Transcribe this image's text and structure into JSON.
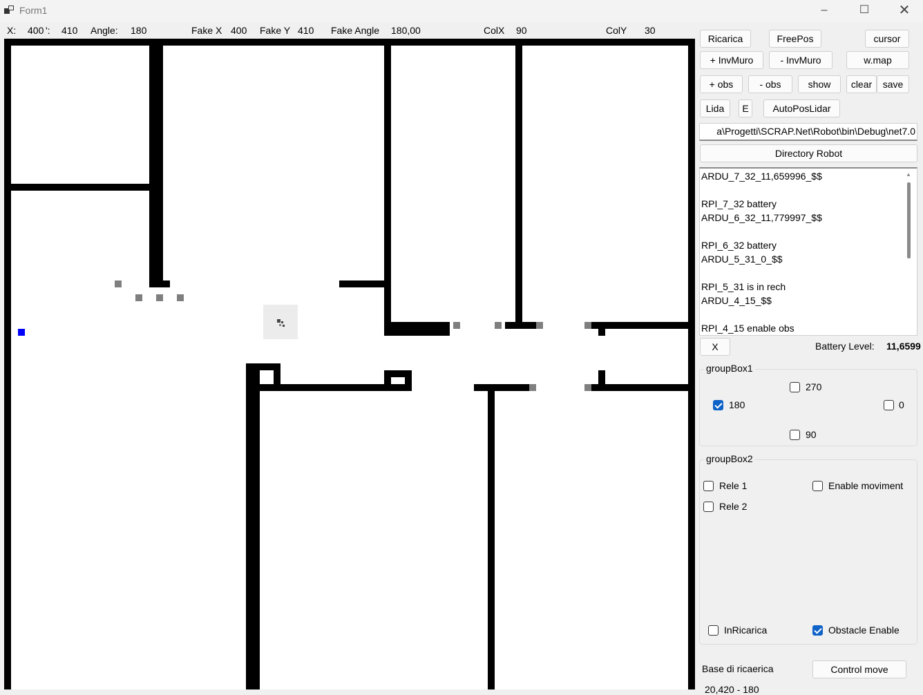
{
  "window": {
    "title": "Form1"
  },
  "status": {
    "x_label": "X:",
    "x_value": "400",
    "y_label": "':",
    "y_value": "410",
    "angle_label": "Angle:",
    "angle_value": "180",
    "fake_x_label": "Fake X",
    "fake_x_value": "400",
    "fake_y_label": "Fake Y",
    "fake_y_value": "410",
    "fake_angle_label": "Fake Angle",
    "fake_angle_value": "180,00",
    "colx_label": "ColX",
    "colx_value": "90",
    "coly_label": "ColY",
    "coly_value": "30"
  },
  "buttons": {
    "ricarica": "Ricarica",
    "freepos": "FreePos",
    "cursor": "cursor",
    "inv_muro_add": "+ InvMuro",
    "inv_muro_remove": "- InvMuro",
    "wmap": "w.map",
    "obs_add": "+ obs",
    "obs_remove": "- obs",
    "show": "show",
    "clear": "clear",
    "save": "save",
    "lida": "Lida",
    "e": "E",
    "autopos": "AutoPosLidar",
    "directory_robot": "Directory Robot",
    "x": "X",
    "control_move": "Control move"
  },
  "path": {
    "value": "a\\Progetti\\SCRAP.Net\\Robot\\bin\\Debug\\net7.0"
  },
  "log": {
    "lines": [
      "ARDU_7_32_11,659996_$$",
      "",
      "RPI_7_32 battery",
      "ARDU_6_32_11,779997_$$",
      "",
      "RPI_6_32 battery",
      "ARDU_5_31_0_$$",
      "",
      "RPI_5_31 is in rech",
      "ARDU_4_15_$$",
      "",
      "RPI_4_15 enable obs"
    ]
  },
  "battery": {
    "label": "Battery Level:",
    "value": "11,6599"
  },
  "groupbox1": {
    "title": "groupBox1",
    "angles": [
      {
        "label": "270",
        "checked": false
      },
      {
        "label": "180",
        "checked": true
      },
      {
        "label": "0",
        "checked": false
      },
      {
        "label": "90",
        "checked": false
      }
    ]
  },
  "groupbox2": {
    "title": "groupBox2",
    "rele1": {
      "label": "Rele 1",
      "checked": false
    },
    "rele2": {
      "label": "Rele 2",
      "checked": false
    },
    "enable_moviment": {
      "label": "Enable moviment",
      "checked": false
    },
    "in_ricarica": {
      "label": "InRicarica",
      "checked": false
    },
    "obstacle_enable": {
      "label": "Obstacle Enable",
      "checked": true
    }
  },
  "base": {
    "label": "Base di ricaerica",
    "value": "20,420 - 180"
  },
  "colors": {
    "wall": "#000000",
    "obstacle": "#7f7f7f",
    "robot_marker": "#0000ff",
    "checked": "#0f62c7"
  }
}
